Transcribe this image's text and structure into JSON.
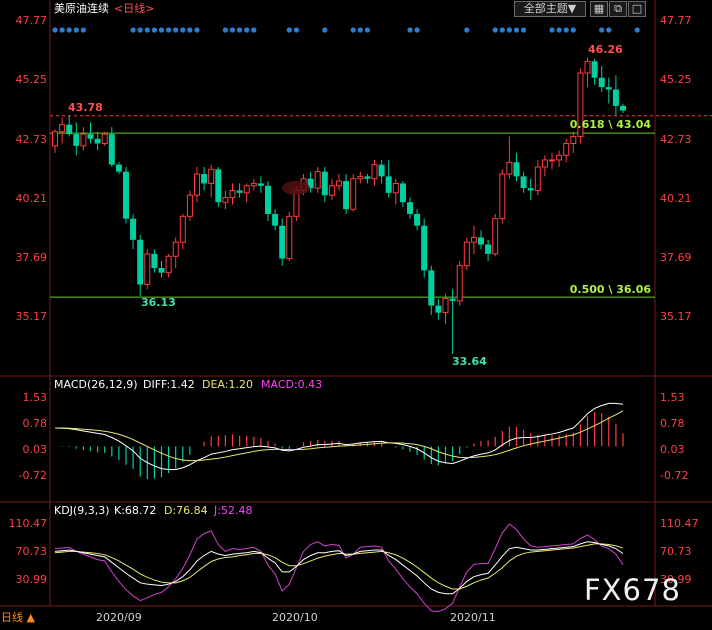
{
  "header": {
    "title": "美原油连续",
    "period": "<日线>",
    "theme_button": "全部主题▼",
    "icons": [
      "grid-icon",
      "restore-icon",
      "maximize-icon"
    ]
  },
  "colors": {
    "up": "#ff3c3c",
    "down": "#00d0a0",
    "axis_red": "#ff4040",
    "fib": "#66cc22",
    "ref_dash": "#ff4040",
    "dot": "#2a80d0",
    "diff": "#ffffff",
    "dea": "#e8e870",
    "macd": "#ff40ff",
    "j": "#d040d0"
  },
  "price_axis": {
    "ticks": [
      "47.77",
      "45.25",
      "42.73",
      "40.21",
      "37.69",
      "35.17"
    ],
    "ref_price": "43.78",
    "low_labels": [
      "36.13",
      "33.64"
    ],
    "high_label": "46.26"
  },
  "fib": {
    "levels": [
      {
        "label": "0.618 \\ 43.04",
        "value": 43.04
      },
      {
        "label": "0.500 \\ 36.06",
        "value": 36.06
      }
    ]
  },
  "macd_panel": {
    "label": "MACD(26,12,9)",
    "diff_text": "DIFF:1.42",
    "dea_text": "DEA:1.20",
    "macd_text": "MACD:0.43",
    "ticks": [
      "1.53",
      "0.78",
      "0.03",
      "-0.72"
    ]
  },
  "kdj_panel": {
    "label": "KDJ(9,3,3)",
    "k_text": "K:68.72",
    "d_text": "D:76.84",
    "j_text": "J:52.48",
    "ticks": [
      "110.47",
      "70.73",
      "30.99"
    ]
  },
  "x_axis": {
    "period_tab": "日线 ▲",
    "months": [
      "2020/09",
      "2020/10",
      "2020/11"
    ]
  },
  "watermark": "FX678",
  "chart_data": {
    "type": "candlestick",
    "y_range": [
      33.0,
      47.9
    ],
    "macd_range": [
      -1.1,
      1.7
    ],
    "kdj_range": [
      -5,
      115
    ],
    "candles": [
      [
        42.5,
        43.2,
        42.2,
        43.1
      ],
      [
        43.1,
        43.7,
        42.6,
        43.4
      ],
      [
        43.4,
        43.8,
        42.9,
        43.0
      ],
      [
        43.0,
        43.5,
        42.1,
        42.5
      ],
      [
        42.5,
        43.3,
        42.3,
        43.0
      ],
      [
        43.0,
        43.5,
        42.6,
        42.8
      ],
      [
        42.8,
        43.1,
        42.3,
        42.6
      ],
      [
        42.6,
        43.1,
        42.5,
        43.0
      ],
      [
        43.0,
        43.3,
        41.6,
        41.7
      ],
      [
        41.7,
        41.8,
        41.3,
        41.4
      ],
      [
        41.4,
        41.6,
        39.2,
        39.4
      ],
      [
        39.4,
        39.6,
        38.1,
        38.5
      ],
      [
        38.5,
        38.7,
        36.1,
        36.6
      ],
      [
        36.6,
        38.1,
        36.4,
        37.9
      ],
      [
        37.9,
        38.1,
        37.1,
        37.3
      ],
      [
        37.3,
        37.6,
        36.9,
        37.1
      ],
      [
        37.1,
        37.9,
        36.9,
        37.8
      ],
      [
        37.8,
        38.6,
        37.3,
        38.4
      ],
      [
        38.4,
        39.6,
        38.1,
        39.5
      ],
      [
        39.5,
        40.6,
        39.3,
        40.4
      ],
      [
        40.4,
        41.6,
        40.1,
        41.3
      ],
      [
        41.3,
        41.6,
        40.6,
        40.9
      ],
      [
        40.9,
        41.7,
        40.3,
        41.5
      ],
      [
        41.5,
        41.6,
        39.9,
        40.1
      ],
      [
        40.1,
        40.6,
        39.8,
        40.3
      ],
      [
        40.3,
        40.9,
        40.0,
        40.6
      ],
      [
        40.6,
        40.9,
        40.3,
        40.5
      ],
      [
        40.5,
        40.9,
        40.1,
        40.8
      ],
      [
        40.8,
        41.1,
        40.6,
        40.9
      ],
      [
        40.9,
        41.2,
        40.5,
        40.8
      ],
      [
        40.8,
        41.0,
        39.3,
        39.6
      ],
      [
        39.6,
        39.8,
        38.9,
        39.1
      ],
      [
        39.1,
        39.4,
        37.4,
        37.7
      ],
      [
        37.7,
        39.7,
        37.6,
        39.5
      ],
      [
        39.5,
        40.8,
        39.3,
        40.6
      ],
      [
        40.6,
        41.3,
        40.4,
        41.1
      ],
      [
        41.1,
        41.4,
        40.5,
        40.7
      ],
      [
        40.7,
        41.6,
        40.5,
        41.4
      ],
      [
        41.4,
        41.6,
        40.1,
        40.4
      ],
      [
        40.4,
        41.1,
        40.2,
        40.8
      ],
      [
        40.8,
        41.3,
        40.6,
        41.0
      ],
      [
        41.0,
        41.3,
        39.6,
        39.8
      ],
      [
        39.8,
        41.3,
        39.7,
        41.1
      ],
      [
        41.1,
        41.4,
        40.9,
        41.2
      ],
      [
        41.2,
        41.3,
        40.9,
        41.1
      ],
      [
        41.1,
        41.9,
        40.8,
        41.7
      ],
      [
        41.7,
        41.9,
        40.9,
        41.2
      ],
      [
        41.2,
        41.9,
        40.3,
        40.5
      ],
      [
        40.5,
        41.1,
        40.0,
        40.9
      ],
      [
        40.9,
        41.0,
        39.9,
        40.1
      ],
      [
        40.1,
        40.3,
        39.4,
        39.6
      ],
      [
        39.6,
        39.8,
        38.9,
        39.1
      ],
      [
        39.1,
        39.4,
        36.9,
        37.2
      ],
      [
        37.2,
        37.4,
        35.3,
        35.7
      ],
      [
        35.7,
        36.0,
        35.1,
        35.4
      ],
      [
        35.4,
        36.2,
        34.9,
        36.0
      ],
      [
        36.0,
        36.4,
        33.64,
        35.9
      ],
      [
        35.9,
        37.6,
        35.7,
        37.4
      ],
      [
        37.4,
        38.6,
        37.2,
        38.4
      ],
      [
        38.4,
        39.1,
        37.9,
        38.6
      ],
      [
        38.6,
        38.9,
        38.1,
        38.3
      ],
      [
        38.3,
        38.5,
        37.6,
        37.9
      ],
      [
        37.9,
        39.6,
        37.8,
        39.4
      ],
      [
        39.4,
        41.5,
        39.2,
        41.3
      ],
      [
        41.3,
        42.9,
        41.1,
        41.8
      ],
      [
        41.8,
        42.2,
        41.0,
        41.2
      ],
      [
        41.2,
        41.4,
        40.5,
        40.7
      ],
      [
        40.7,
        41.1,
        40.2,
        40.6
      ],
      [
        40.6,
        41.9,
        40.4,
        41.6
      ],
      [
        41.6,
        42.1,
        41.2,
        41.9
      ],
      [
        41.9,
        42.2,
        41.5,
        41.9
      ],
      [
        41.9,
        42.3,
        41.6,
        42.1
      ],
      [
        42.1,
        42.8,
        41.8,
        42.6
      ],
      [
        42.6,
        43.1,
        42.2,
        42.9
      ],
      [
        42.9,
        45.8,
        42.6,
        45.6
      ],
      [
        45.6,
        46.26,
        45.0,
        46.1
      ],
      [
        46.1,
        46.2,
        45.1,
        45.4
      ],
      [
        45.4,
        45.9,
        44.8,
        45.0
      ],
      [
        45.0,
        45.4,
        44.3,
        44.9
      ],
      [
        44.9,
        45.5,
        43.8,
        44.2
      ],
      [
        44.2,
        44.3,
        43.9,
        44.0
      ]
    ],
    "macd": {
      "diff": [
        0.62,
        0.61,
        0.6,
        0.56,
        0.52,
        0.48,
        0.44,
        0.4,
        0.3,
        0.18,
        0.02,
        -0.15,
        -0.4,
        -0.55,
        -0.66,
        -0.75,
        -0.78,
        -0.78,
        -0.72,
        -0.62,
        -0.48,
        -0.38,
        -0.26,
        -0.22,
        -0.17,
        -0.11,
        -0.08,
        -0.04,
        -0.01,
        0.01,
        -0.02,
        -0.05,
        -0.13,
        -0.15,
        -0.1,
        -0.03,
        0.01,
        0.06,
        0.06,
        0.08,
        0.1,
        0.06,
        0.08,
        0.12,
        0.14,
        0.16,
        0.17,
        0.12,
        0.1,
        0.06,
        0.0,
        -0.08,
        -0.22,
        -0.38,
        -0.5,
        -0.55,
        -0.58,
        -0.5,
        -0.4,
        -0.32,
        -0.26,
        -0.22,
        -0.12,
        0.05,
        0.2,
        0.28,
        0.3,
        0.3,
        0.33,
        0.38,
        0.42,
        0.47,
        0.55,
        0.62,
        0.85,
        1.1,
        1.28,
        1.38,
        1.45,
        1.45,
        1.42
      ],
      "dea": [
        0.62,
        0.62,
        0.61,
        0.6,
        0.58,
        0.56,
        0.54,
        0.51,
        0.47,
        0.41,
        0.33,
        0.23,
        0.11,
        0.0,
        -0.12,
        -0.23,
        -0.33,
        -0.41,
        -0.46,
        -0.48,
        -0.48,
        -0.46,
        -0.43,
        -0.4,
        -0.36,
        -0.31,
        -0.26,
        -0.22,
        -0.17,
        -0.13,
        -0.11,
        -0.1,
        -0.1,
        -0.11,
        -0.11,
        -0.1,
        -0.08,
        -0.05,
        -0.03,
        -0.01,
        0.01,
        0.02,
        0.03,
        0.05,
        0.07,
        0.09,
        0.11,
        0.12,
        0.12,
        0.11,
        0.09,
        0.06,
        0.0,
        -0.08,
        -0.18,
        -0.26,
        -0.33,
        -0.37,
        -0.38,
        -0.37,
        -0.35,
        -0.32,
        -0.28,
        -0.21,
        -0.13,
        -0.05,
        0.02,
        0.08,
        0.13,
        0.18,
        0.23,
        0.28,
        0.34,
        0.39,
        0.48,
        0.59,
        0.7,
        0.82,
        0.95,
        1.07,
        1.2
      ]
    },
    "kdj": {
      "k": [
        72,
        73,
        74,
        72,
        70,
        68,
        66,
        64,
        56,
        48,
        40,
        33,
        26,
        24,
        23,
        22,
        24,
        28,
        35,
        45,
        58,
        66,
        72,
        68,
        66,
        68,
        69,
        70,
        72,
        70,
        62,
        55,
        42,
        42,
        50,
        60,
        66,
        70,
        70,
        72,
        73,
        66,
        68,
        72,
        73,
        74,
        74,
        66,
        60,
        52,
        44,
        36,
        26,
        17,
        12,
        10,
        10,
        18,
        28,
        35,
        38,
        40,
        52,
        65,
        76,
        78,
        76,
        74,
        74,
        75,
        76,
        77,
        78,
        79,
        83,
        86,
        85,
        82,
        80,
        76,
        68.72
      ],
      "d": [
        70,
        71,
        72,
        72,
        71,
        70,
        69,
        67,
        63,
        58,
        52,
        46,
        39,
        34,
        30,
        27,
        26,
        26,
        29,
        34,
        42,
        50,
        57,
        61,
        63,
        64,
        66,
        67,
        69,
        69,
        67,
        63,
        56,
        51,
        51,
        54,
        58,
        62,
        65,
        67,
        69,
        68,
        68,
        69,
        70,
        71,
        72,
        70,
        67,
        62,
        56,
        49,
        41,
        33,
        26,
        21,
        17,
        17,
        21,
        26,
        30,
        33,
        40,
        48,
        58,
        65,
        69,
        71,
        72,
        73,
        74,
        75,
        76,
        77,
        79,
        81,
        83,
        83,
        82,
        80,
        76.84
      ],
      "j": [
        76,
        77,
        78,
        72,
        68,
        64,
        60,
        58,
        42,
        28,
        16,
        7,
        0,
        4,
        9,
        12,
        20,
        32,
        47,
        67,
        90,
        98,
        102,
        82,
        72,
        76,
        75,
        76,
        78,
        72,
        52,
        39,
        14,
        24,
        48,
        72,
        82,
        86,
        80,
        82,
        81,
        62,
        68,
        78,
        79,
        80,
        78,
        58,
        46,
        32,
        20,
        10,
        -4,
        -15,
        -16,
        -12,
        -4,
        20,
        42,
        53,
        54,
        54,
        76,
        99,
        112,
        104,
        90,
        80,
        78,
        79,
        80,
        81,
        82,
        83,
        91,
        96,
        89,
        80,
        76,
        68,
        52.48
      ]
    }
  }
}
